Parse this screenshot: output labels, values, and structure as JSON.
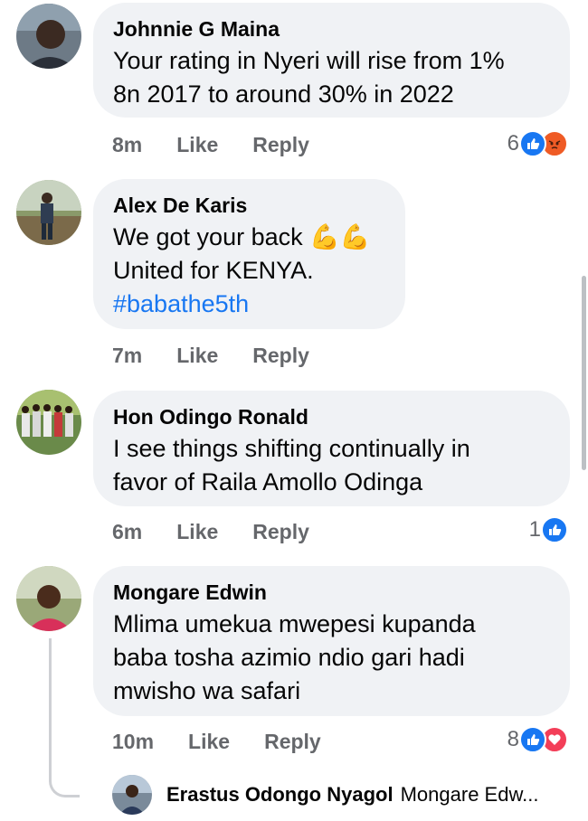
{
  "comments": [
    {
      "author": "Johnnie G Maina",
      "lines": [
        "Your rating in Nyeri will rise from 1%",
        "8n 2017 to around 30% in 2022"
      ],
      "time": "8m",
      "like": "Like",
      "reply": "Reply",
      "reaction_count": "6",
      "reactions": [
        "like-icon",
        "angry-icon"
      ]
    },
    {
      "author": "Alex De Karis",
      "lines": [
        "We got your back 💪💪",
        "United for KENYA."
      ],
      "hashtag": "#babathe5th",
      "time": "7m",
      "like": "Like",
      "reply": "Reply"
    },
    {
      "author": "Hon Odingo Ronald",
      "lines": [
        "I see things shifting continually in",
        "favor of Raila Amollo Odinga"
      ],
      "time": "6m",
      "like": "Like",
      "reply": "Reply",
      "reaction_count": "1",
      "reactions": [
        "like-icon"
      ]
    },
    {
      "author": "Mongare Edwin",
      "lines": [
        "Mlima umekua mwepesi kupanda",
        "baba tosha azimio ndio gari hadi",
        "mwisho wa safari"
      ],
      "time": "10m",
      "like": "Like",
      "reply": "Reply",
      "reaction_count": "8",
      "reactions": [
        "like-icon",
        "love-icon"
      ]
    }
  ],
  "reply_preview": {
    "author": "Erastus Odongo Nyagol",
    "text": "Mongare Edw..."
  },
  "colors": {
    "bubble": "#f0f2f5",
    "accent": "#1877f2",
    "muted": "#65676b"
  }
}
